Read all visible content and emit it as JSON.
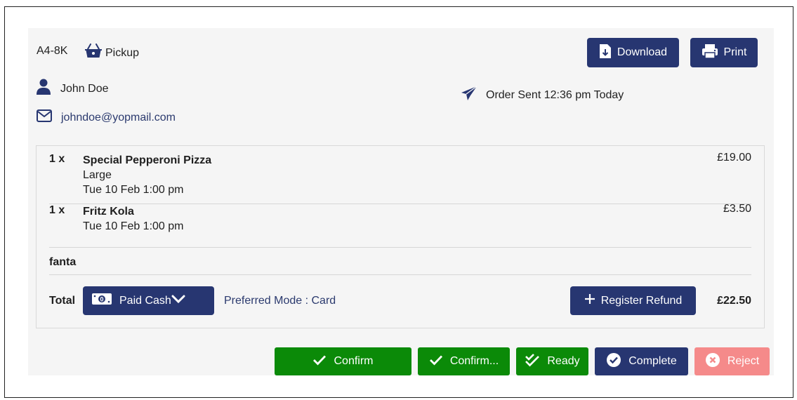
{
  "order": {
    "code": "A4-8K",
    "type": "Pickup",
    "sent_status": "Order Sent 12:36 pm Today"
  },
  "customer": {
    "name": "John Doe",
    "email": "johndoe@yopmail.com"
  },
  "toolbar": {
    "download_label": "Download",
    "print_label": "Print"
  },
  "items": [
    {
      "qty": "1 x",
      "name": "Special Pepperoni Pizza",
      "option": "Large",
      "time": "Tue 10 Feb 1:00 pm",
      "price": "£19.00"
    },
    {
      "qty": "1 x",
      "name": "Fritz Kola",
      "time": "Tue 10 Feb 1:00 pm",
      "price": "£3.50"
    }
  ],
  "note": "fanta",
  "payment": {
    "total_label": "Total",
    "status": "Paid Cash",
    "preferred": "Preferred Mode : Card",
    "refund_label": "Register Refund",
    "total_amount": "£22.50"
  },
  "actions": {
    "confirm": "Confirm",
    "confirm_truncated": "Confirm...",
    "ready": "Ready",
    "complete": "Complete",
    "reject": "Reject"
  },
  "colors": {
    "navy": "#273671",
    "green": "#0b8a08",
    "reject": "#f58a8a",
    "panel": "#f5f5f5"
  }
}
